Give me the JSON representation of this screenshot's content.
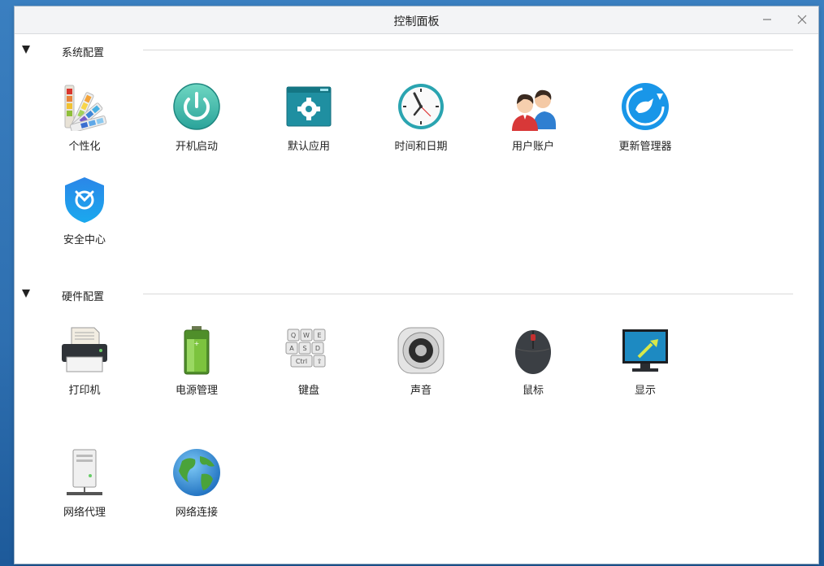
{
  "window": {
    "title": "控制面板"
  },
  "sections": [
    {
      "title": "系统配置",
      "items": [
        {
          "label": "个性化",
          "icon": "palette-icon"
        },
        {
          "label": "开机启动",
          "icon": "power-icon"
        },
        {
          "label": "默认应用",
          "icon": "window-gear-icon"
        },
        {
          "label": "时间和日期",
          "icon": "clock-icon"
        },
        {
          "label": "用户账户",
          "icon": "users-icon"
        },
        {
          "label": "更新管理器",
          "icon": "update-icon"
        },
        {
          "label": "安全中心",
          "icon": "shield-icon"
        }
      ]
    },
    {
      "title": "硬件配置",
      "items": [
        {
          "label": "打印机",
          "icon": "printer-icon"
        },
        {
          "label": "电源管理",
          "icon": "battery-icon"
        },
        {
          "label": "键盘",
          "icon": "keyboard-icon"
        },
        {
          "label": "声音",
          "icon": "speaker-icon"
        },
        {
          "label": "鼠标",
          "icon": "mouse-icon"
        },
        {
          "label": "显示",
          "icon": "monitor-icon"
        },
        {
          "label": "网络代理",
          "icon": "server-icon"
        },
        {
          "label": "网络连接",
          "icon": "globe-icon"
        }
      ]
    }
  ]
}
